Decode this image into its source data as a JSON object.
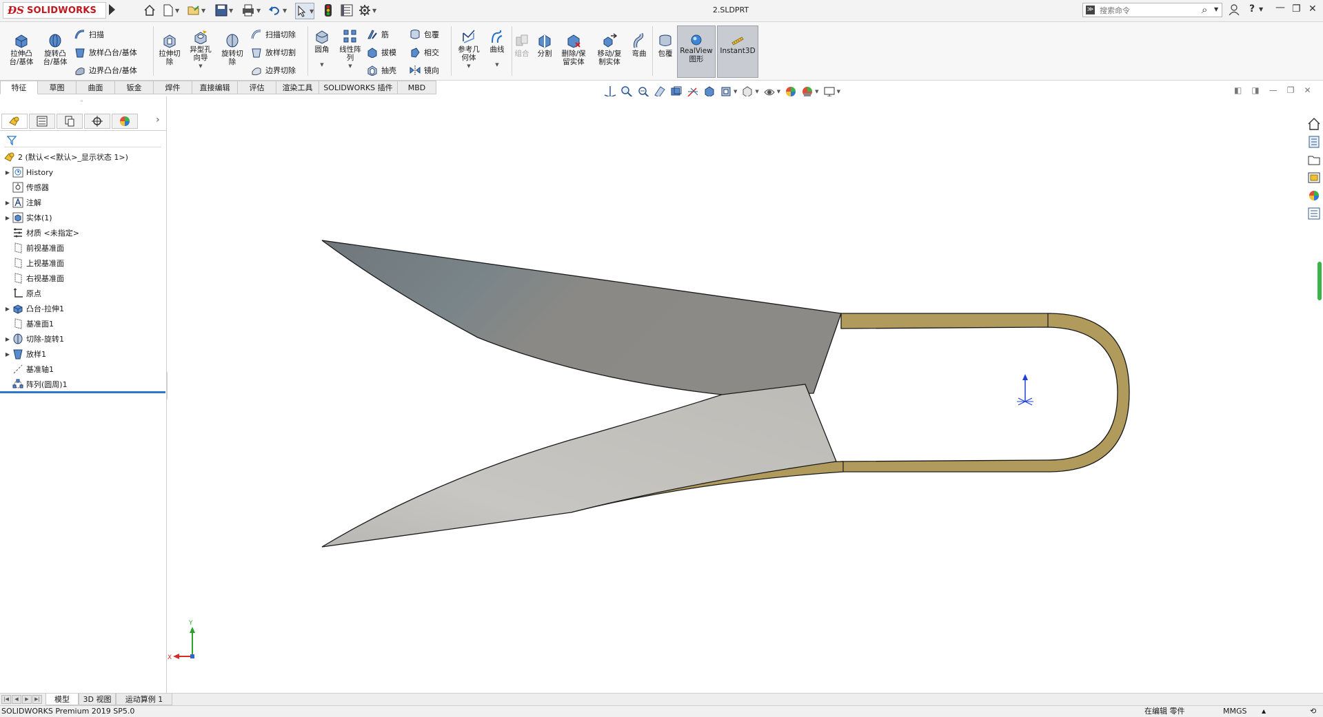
{
  "app": {
    "brand": "SOLIDWORKS",
    "document_title": "2.SLDPRT",
    "search_placeholder": "搜索命令"
  },
  "command_manager": {
    "extrude_boss": "拉伸凸\n台/基体",
    "revolve_boss": "旋转凸\n台/基体",
    "sweep": "扫描",
    "loft_boss": "放样凸台/基体",
    "boundary_boss": "边界凸台/基体",
    "extrude_cut": "拉伸切\n除",
    "hole_wizard": "异型孔\n向导",
    "revolve_cut": "旋转切\n除",
    "swept_cut": "扫描切除",
    "lofted_cut": "放样切割",
    "boundary_cut": "边界切除",
    "fillet": "圆角",
    "linear_pattern": "线性阵\n列",
    "rib": "筋",
    "draft": "拔模",
    "shell": "抽壳",
    "wrap": "包覆",
    "intersect": "相交",
    "mirror": "镜向",
    "ref_geometry": "参考几\n何体",
    "curves": "曲线",
    "combine": "组合",
    "split": "分割",
    "delete_keep_body": "删除/保\n留实体",
    "move_copy_body": "移动/复\n制实体",
    "flex": "弯曲",
    "wrap2": "包覆",
    "realview": "RealView\n图形",
    "instant3d": "Instant3D"
  },
  "tabs": [
    "特征",
    "草图",
    "曲面",
    "钣金",
    "焊件",
    "直接编辑",
    "评估",
    "渲染工具",
    "SOLIDWORKS 插件",
    "MBD"
  ],
  "feature_tree": {
    "root": "2 (默认<<默认>_显示状态 1>)",
    "items": [
      {
        "label": "History",
        "expandable": true,
        "icon": "history-icon"
      },
      {
        "label": "传感器",
        "expandable": false,
        "icon": "sensor-icon"
      },
      {
        "label": "注解",
        "expandable": true,
        "icon": "annotation-icon"
      },
      {
        "label": "实体(1)",
        "expandable": true,
        "icon": "solid-bodies-icon"
      },
      {
        "label": "材质 <未指定>",
        "expandable": false,
        "icon": "material-icon"
      },
      {
        "label": "前视基准面",
        "expandable": false,
        "icon": "plane-icon"
      },
      {
        "label": "上视基准面",
        "expandable": false,
        "icon": "plane-icon"
      },
      {
        "label": "右视基准面",
        "expandable": false,
        "icon": "plane-icon"
      },
      {
        "label": "原点",
        "expandable": false,
        "icon": "origin-icon"
      },
      {
        "label": "凸台-拉伸1",
        "expandable": true,
        "icon": "extrude-icon"
      },
      {
        "label": "基准面1",
        "expandable": false,
        "icon": "plane-icon"
      },
      {
        "label": "切除-旋转1",
        "expandable": true,
        "icon": "revolve-cut-icon"
      },
      {
        "label": "放样1",
        "expandable": true,
        "icon": "loft-icon"
      },
      {
        "label": "基准轴1",
        "expandable": false,
        "icon": "axis-icon"
      },
      {
        "label": "阵列(圆周)1",
        "expandable": false,
        "icon": "circular-pattern-icon"
      }
    ]
  },
  "bottom_tabs": [
    "模型",
    "3D 视图",
    "运动算例 1"
  ],
  "status": {
    "product": "SOLIDWORKS Premium 2019 SP5.0",
    "editing": "在编辑 零件",
    "units": "MMGS"
  },
  "triad": {
    "x": "X",
    "y": "Y"
  },
  "colors": {
    "blade_dark": "#7d8488",
    "blade_light": "#c2c0bb",
    "handle": "#b09a5c",
    "accent_blue": "#2b78c8"
  }
}
